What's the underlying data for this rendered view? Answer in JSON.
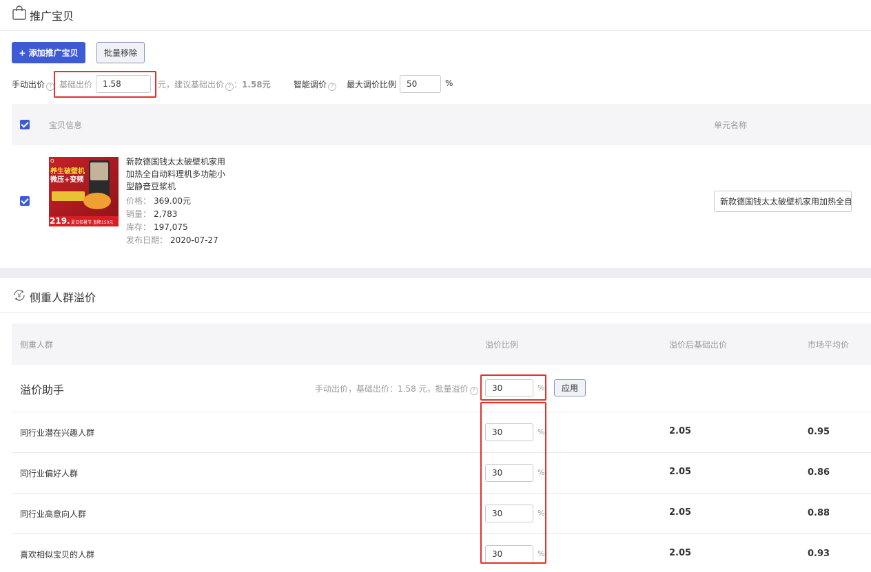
{
  "promote": {
    "title": "推广宝贝",
    "add_button": "+ 添加推广宝贝",
    "batch_remove_button": "批量移除",
    "manual_bid_label": "手动出价",
    "base_bid_label": "基础出价",
    "base_bid_value": "1.58",
    "unit_yuan": "元，建议基础出价",
    "suggested_label_suffix": "：",
    "suggested_value": "1.58元",
    "smart_adjust_label": "智能调价",
    "max_ratio_label": "最大调价比例",
    "max_ratio_value": "50",
    "percent": "%"
  },
  "product_table": {
    "col_info": "宝贝信息",
    "col_unit": "单元名称",
    "product": {
      "image_text_top": "养生破壁机",
      "image_text_sub": "微压+变频",
      "image_price": "219.",
      "image_banner": "夏日狂暑节 直降150元",
      "title": "新款德国钱太太破壁机家用加热全自动料理机多功能小型静音豆浆机",
      "price_label": "价格：",
      "price_value": "369.00元",
      "sales_label": "销量：",
      "sales_value": "2,783",
      "stock_label": "库存：",
      "stock_value": "197,075",
      "date_label": "发布日期：",
      "date_value": "2020-07-27",
      "unit_name": "新款德国钱太太破壁机家用加热全自"
    }
  },
  "premium": {
    "title": "侧重人群溢价",
    "col_crowd": "侧重人群",
    "col_ratio": "溢价比例",
    "col_after": "溢价后基础出价",
    "col_market": "市场平均价",
    "assistant_label": "溢价助手",
    "assistant_hint": "手动出价，基础出价：1.58 元，批量溢价",
    "assistant_value": "30",
    "apply_button": "应用",
    "rows": [
      {
        "name": "同行业潜在兴趣人群",
        "ratio": "30",
        "after": "2.05",
        "market": "0.95"
      },
      {
        "name": "同行业偏好人群",
        "ratio": "30",
        "after": "2.05",
        "market": "0.86"
      },
      {
        "name": "同行业高意向人群",
        "ratio": "30",
        "after": "2.05",
        "market": "0.88"
      },
      {
        "name": "喜欢相似宝贝的人群",
        "ratio": "30",
        "after": "2.05",
        "market": "0.93"
      }
    ]
  },
  "colors": {
    "primary": "#3e5bd6",
    "highlight_red": "#e0312b"
  },
  "icons": {
    "bag": "shopping-bag-icon",
    "yen": "yen-cycle-icon",
    "help": "question-circle-icon"
  }
}
